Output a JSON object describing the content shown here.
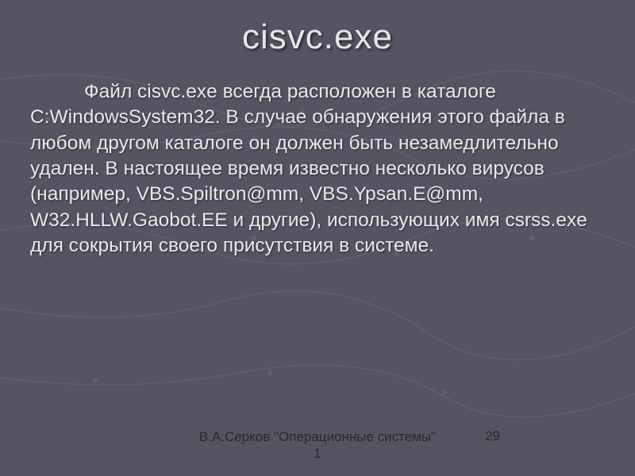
{
  "title": "cisvc.exe",
  "body": "Файл cisvc.exe всегда расположен в каталоге C:WindowsSystem32. В случае обнаружения этого файла в любом другом каталоге он должен быть незамедлительно удален. В настоящее время известно несколько вирусов (например, VBS.Spiltron@mm, VBS.Ypsan.E@mm, W32.HLLW.Gaobot.EE и другие), использующих имя csrss.exe для сокрытия своего присутствия в системе.",
  "footer_center": "В.А.Серков \"Операционные системы\" 1",
  "slide_number": "29"
}
